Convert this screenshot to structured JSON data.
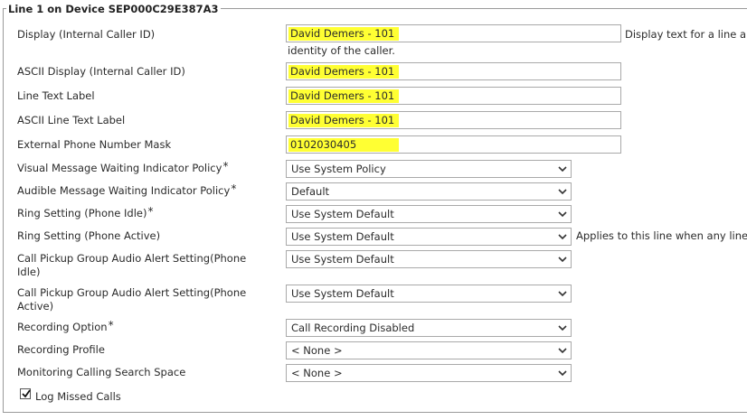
{
  "section": {
    "title": "Line 1 on Device SEP000C29E387A3"
  },
  "fields": {
    "display": {
      "label": "Display (Internal Caller ID)",
      "value": "David Demers - 101",
      "help_line1": "Display text for a line a",
      "help_line2": "identity of the caller."
    },
    "ascii_display": {
      "label": "ASCII Display (Internal Caller ID)",
      "value": "David Demers - 101"
    },
    "line_text_label": {
      "label": "Line Text Label",
      "value": "David Demers - 101"
    },
    "ascii_line_text_label": {
      "label": "ASCII Line Text Label",
      "value": "David Demers - 101"
    },
    "external_mask": {
      "label": "External Phone Number Mask",
      "value": "0102030405"
    },
    "visual_mwi": {
      "label": "Visual Message Waiting Indicator Policy",
      "required": "*",
      "value": "Use System Policy"
    },
    "audible_mwi": {
      "label": "Audible Message Waiting Indicator Policy",
      "required": "*",
      "value": "Default"
    },
    "ring_idle": {
      "label": "Ring Setting (Phone Idle)",
      "required": "*",
      "value": "Use System Default"
    },
    "ring_active": {
      "label": "Ring Setting (Phone Active)",
      "value": "Use System Default",
      "help": "Applies to this line when any line"
    },
    "pickup_idle": {
      "label_line1": "Call Pickup Group Audio Alert Setting(Phone",
      "label_line2": "Idle)",
      "value": "Use System Default"
    },
    "pickup_active": {
      "label_line1": "Call Pickup Group Audio Alert Setting(Phone",
      "label_line2": "Active)",
      "value": "Use System Default"
    },
    "recording_option": {
      "label": "Recording Option",
      "required": "*",
      "value": "Call Recording Disabled"
    },
    "recording_profile": {
      "label": "Recording Profile",
      "value": "< None >"
    },
    "monitoring_css": {
      "label": "Monitoring Calling Search Space",
      "value": "< None >"
    },
    "log_missed_calls": {
      "label": "Log Missed Calls",
      "checked": true
    }
  },
  "colors": {
    "highlight": "#ffff33",
    "border": "#a9a9a9"
  }
}
